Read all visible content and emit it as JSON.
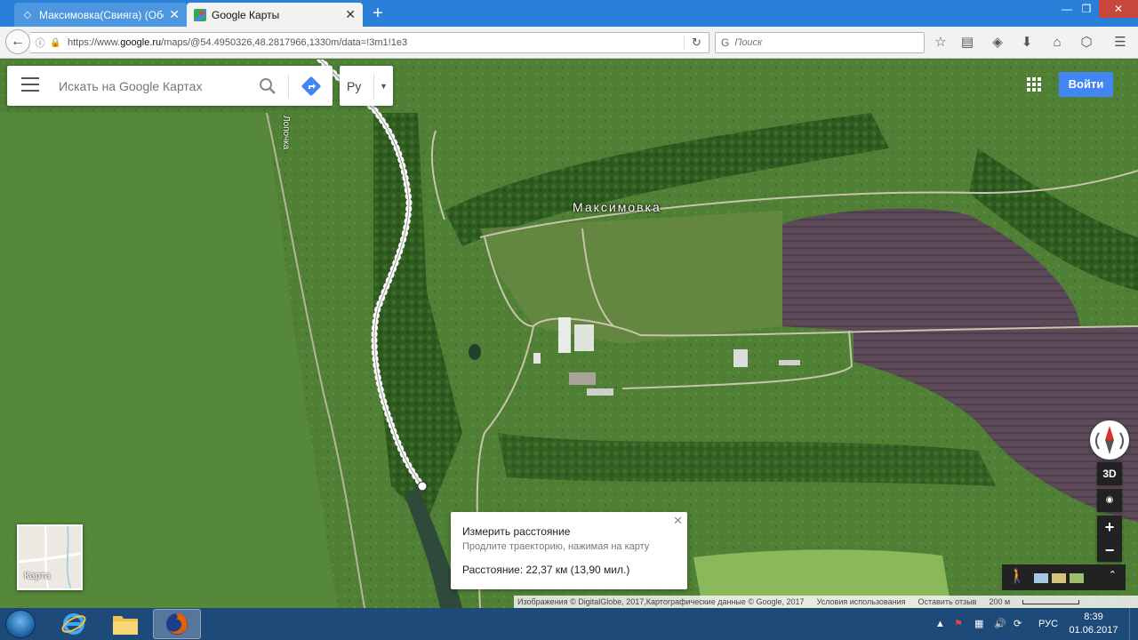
{
  "browser": {
    "tabs": [
      {
        "label": "Максимовка(Свияга) (Обс"
      },
      {
        "label": "Google Карты"
      }
    ],
    "url_prefix": "https://www.",
    "url_domain": "google.ru",
    "url_rest": "/maps/@54.4950326,48.2817966,1330m/data=!3m1!1e3",
    "search_placeholder": "Поиск"
  },
  "map": {
    "search_placeholder": "Искать на Google Картах",
    "language": "Ру",
    "signin_label": "Войти",
    "place_label": "Максимовка",
    "river_label": "Лопочка",
    "button_3d": "3D",
    "button_plus": "+",
    "button_minus": "−",
    "minimap_label": "Карта",
    "measure": {
      "title": "Измерить расстояние",
      "subtitle": "Продлите траекторию, нажимая на карту",
      "distance": "Расстояние: 22,37 км (13,90 мил.)"
    },
    "attribution": {
      "imagery": "Изображения © DigitalGlobe, 2017,Картографические данные © Google, 2017",
      "terms": "Условия использования",
      "feedback": "Оставить отзыв",
      "scale": "200 м"
    },
    "colors": {
      "accent": "#4285f4",
      "field_dark": "#5a4a55",
      "grass": "#4d7a32"
    }
  },
  "taskbar": {
    "language": "РУС",
    "time": "8:39",
    "date": "01.06.2017"
  }
}
